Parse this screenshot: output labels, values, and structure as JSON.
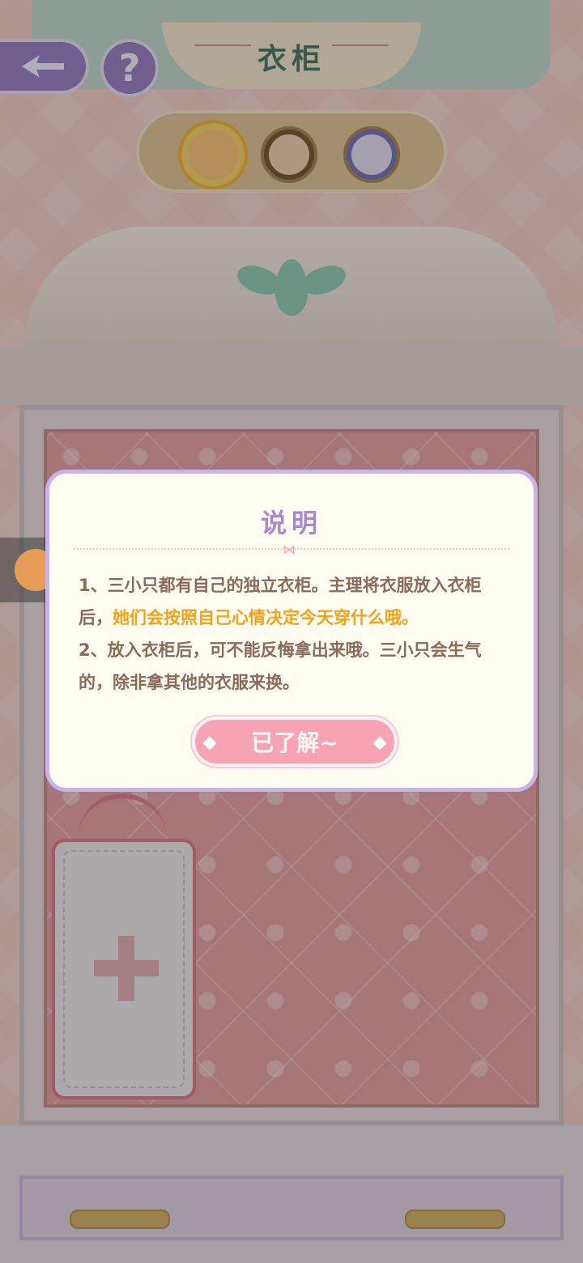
{
  "header": {
    "title": "衣柜",
    "back_icon": "arrow-left-icon",
    "help_label": "?"
  },
  "characters": [
    {
      "name": "character-1",
      "selected": true
    },
    {
      "name": "character-2",
      "selected": false
    },
    {
      "name": "character-3",
      "selected": false
    }
  ],
  "dialog": {
    "title": "说明",
    "line1_prefix": "1、三小只都有自己的独立衣柜。主理将衣服放入衣柜后，",
    "line1_highlight": "她们会按照自己心情决定今天穿什么哦。",
    "line2": "2、放入衣柜后，可不能反悔拿出来哦。三小只会生气的，除非拿其他的衣服来换。",
    "confirm_label": "已了解~"
  },
  "colors": {
    "dialog_border": "#c7b5ea",
    "highlight": "#f2a21a",
    "button": "#f7a3b4"
  }
}
